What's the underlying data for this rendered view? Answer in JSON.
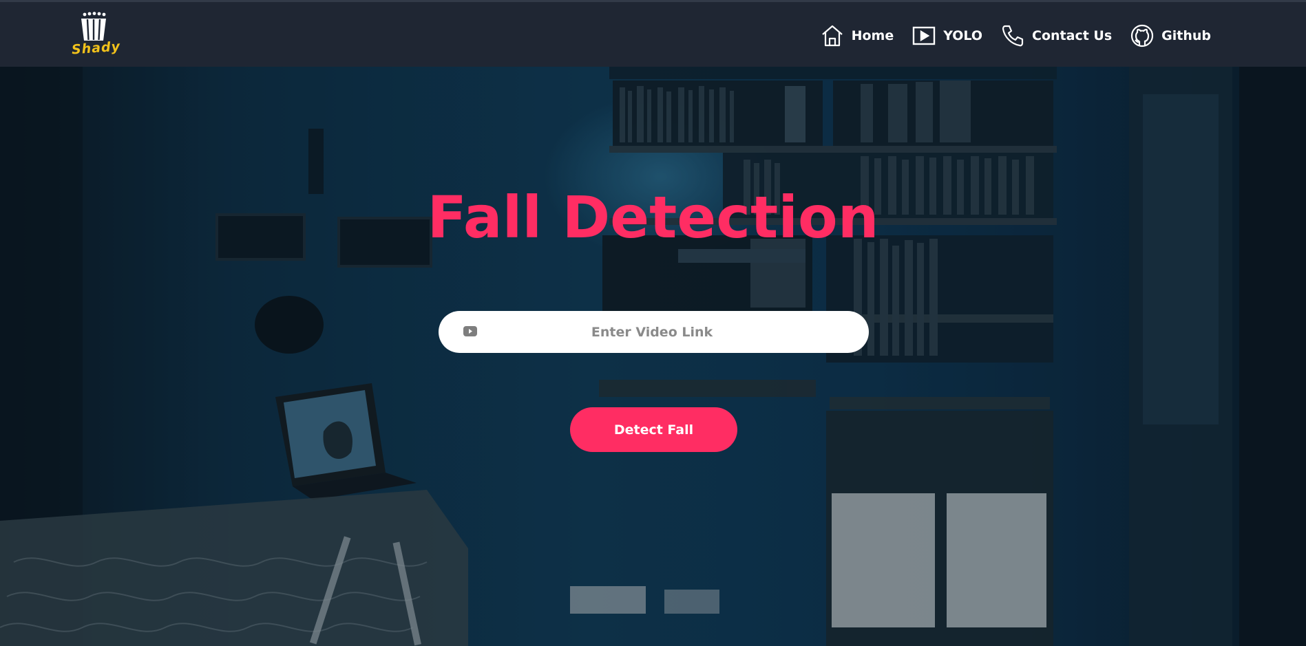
{
  "brand": {
    "name": "Shady",
    "logo_icon": "popcorn-bucket-icon",
    "logo_color": "#f2c21b"
  },
  "nav": {
    "items": [
      {
        "label": "Home",
        "icon": "home-icon"
      },
      {
        "label": "YOLO",
        "icon": "play-icon"
      },
      {
        "label": "Contact Us",
        "icon": "phone-icon"
      },
      {
        "label": "Github",
        "icon": "github-icon"
      }
    ]
  },
  "hero": {
    "title": "Fall Detection",
    "search": {
      "placeholder": "Enter Video Link",
      "value": "",
      "icon": "youtube-icon"
    },
    "detect_button_label": "Detect Fall"
  },
  "colors": {
    "accent": "#ff2d63",
    "navbar": "#1f2633",
    "text_light": "#ffffff"
  }
}
